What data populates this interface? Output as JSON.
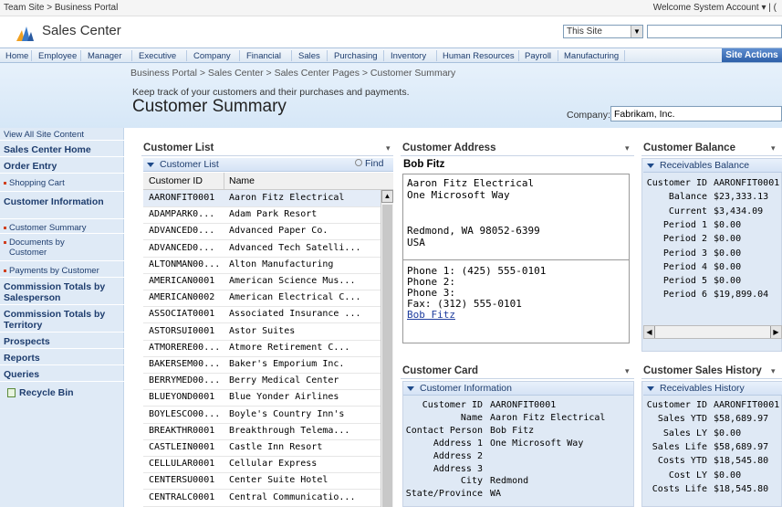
{
  "topbar": {
    "breadcrumb": "Team Site > Business Portal",
    "welcome": "Welcome System Account ▾ | ("
  },
  "header": {
    "site_title": "Sales Center",
    "scope": "This Site"
  },
  "nav": {
    "items": [
      "Home",
      "Employee",
      "Manager",
      "Executive",
      "Company",
      "Financial",
      "Sales",
      "Purchasing",
      "Inventory",
      "Human Resources",
      "Payroll",
      "Manufacturing"
    ],
    "site_actions": "Site Actions"
  },
  "title_area": {
    "breadcrumb": "Business Portal > Sales Center > Sales Center Pages > Customer Summary",
    "description": "Keep track of your customers and their purchases and payments.",
    "page_title": "Customer Summary",
    "company_label": "Company:",
    "company_value": "Fabrikam, Inc."
  },
  "leftnav": {
    "items": [
      "View All Site Content",
      "Sales Center Home",
      "Order Entry",
      "Shopping Cart",
      "Customer Information",
      "Customer Summary",
      "Documents by Customer",
      "Payments by Customer",
      "Commission Totals by Salesperson",
      "Commission Totals by Territory",
      "Prospects",
      "Reports",
      "Queries",
      "Recycle Bin"
    ]
  },
  "customer_list": {
    "title": "Customer List",
    "menu": "▾",
    "subheader": "Customer List",
    "find": "Find",
    "columns": [
      "Customer ID",
      "Name"
    ],
    "rows": [
      [
        "AARONFIT0001",
        "Aaron Fitz Electrical"
      ],
      [
        "ADAMPARK0...",
        "Adam Park Resort"
      ],
      [
        "ADVANCED0...",
        "Advanced Paper Co."
      ],
      [
        "ADVANCED0...",
        "Advanced Tech Satelli..."
      ],
      [
        "ALTONMAN00...",
        "Alton Manufacturing"
      ],
      [
        "AMERICAN0001",
        "American Science Mus..."
      ],
      [
        "AMERICAN0002",
        "American Electrical C..."
      ],
      [
        "ASSOCIAT0001",
        "Associated Insurance ..."
      ],
      [
        "ASTORSUI0001",
        "Astor Suites"
      ],
      [
        "ATMORERE00...",
        "Atmore Retirement C..."
      ],
      [
        "BAKERSEM00...",
        "Baker's Emporium Inc."
      ],
      [
        "BERRYMED00...",
        "Berry Medical Center"
      ],
      [
        "BLUEYOND0001",
        "Blue Yonder Airlines"
      ],
      [
        "BOYLESCO00...",
        "Boyle's Country Inn's"
      ],
      [
        "BREAKTHR0001",
        "Breakthrough Telema..."
      ],
      [
        "CASTLEIN0001",
        "Castle Inn Resort"
      ],
      [
        "CELLULAR0001",
        "Cellular Express"
      ],
      [
        "CENTERSU0001",
        "Center Suite Hotel"
      ],
      [
        "CENTRALC0001",
        "Central Communicatio..."
      ]
    ]
  },
  "customer_address": {
    "title": "Customer Address",
    "menu": "▾",
    "name": "Bob Fitz",
    "lines": [
      "Aaron Fitz Electrical",
      "One Microsoft Way",
      "",
      "",
      "Redmond, WA  98052-6399",
      "USA"
    ],
    "phones": [
      "Phone 1: (425) 555-0101",
      "Phone 2:",
      "Phone 3:",
      "Fax: (312) 555-0101"
    ],
    "contact_link": "Bob Fitz"
  },
  "customer_balance": {
    "title": "Customer Balance",
    "menu": "▾",
    "subheader": "Receivables Balance",
    "fields": [
      [
        "Customer ID",
        "AARONFIT0001"
      ],
      [
        "Balance",
        "$23,333.13"
      ],
      [
        "Current",
        "$3,434.09"
      ],
      [
        "Period 1",
        "$0.00"
      ],
      [
        "Period 2",
        "$0.00"
      ],
      [
        "Period 3",
        "$0.00"
      ],
      [
        "Period 4",
        "$0.00"
      ],
      [
        "Period 5",
        "$0.00"
      ],
      [
        "Period 6",
        "$19,899.04"
      ]
    ]
  },
  "customer_card": {
    "title": "Customer Card",
    "menu": "▾",
    "subheader": "Customer Information",
    "fields": [
      [
        "Customer ID",
        "AARONFIT0001"
      ],
      [
        "Name",
        "Aaron Fitz Electrical"
      ],
      [
        "Contact Person",
        "Bob Fitz"
      ],
      [
        "Address 1",
        "One Microsoft Way"
      ],
      [
        "Address 2",
        ""
      ],
      [
        "Address 3",
        ""
      ],
      [
        "City",
        "Redmond"
      ],
      [
        "State/Province",
        "WA"
      ]
    ]
  },
  "sales_history": {
    "title": "Customer Sales History",
    "menu": "▾",
    "subheader": "Receivables History",
    "fields": [
      [
        "Customer ID",
        "AARONFIT0001"
      ],
      [
        "Sales YTD",
        "$58,689.97"
      ],
      [
        "Sales LY",
        "$0.00"
      ],
      [
        "Sales Life",
        "$58,689.97"
      ],
      [
        "Costs YTD",
        "$18,545.80"
      ],
      [
        "Cost LY",
        "$0.00"
      ],
      [
        "Costs Life",
        "$18,545.80"
      ]
    ]
  }
}
